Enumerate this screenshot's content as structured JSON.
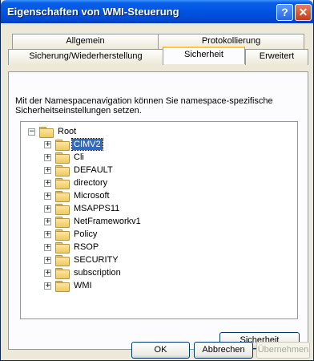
{
  "window": {
    "title": "Eigenschaften von WMI-Steuerung"
  },
  "tabs": {
    "row1": [
      {
        "label": "Allgemein"
      },
      {
        "label": "Protokollierung"
      }
    ],
    "row2": [
      {
        "label": "Sicherung/Wiederherstellung"
      },
      {
        "label": "Sicherheit",
        "active": true
      },
      {
        "label": "Erweitert"
      }
    ]
  },
  "panel": {
    "description": "Mit der Namespacenavigation können Sie namespace-spezifische Sicherheitseinstellungen setzen.",
    "tree": {
      "root": {
        "label": "Root",
        "expander": "−"
      },
      "children": [
        {
          "label": "CIMV2",
          "selected": true,
          "expander": "+"
        },
        {
          "label": "Cli",
          "expander": "+"
        },
        {
          "label": "DEFAULT",
          "expander": "+"
        },
        {
          "label": "directory",
          "expander": "+"
        },
        {
          "label": "Microsoft",
          "expander": "+"
        },
        {
          "label": "MSAPPS11",
          "expander": "+"
        },
        {
          "label": "NetFrameworkv1",
          "expander": "+"
        },
        {
          "label": "Policy",
          "expander": "+"
        },
        {
          "label": "RSOP",
          "expander": "+"
        },
        {
          "label": "SECURITY",
          "expander": "+"
        },
        {
          "label": "subscription",
          "expander": "+"
        },
        {
          "label": "WMI",
          "expander": "+"
        }
      ]
    },
    "security_button": "Sicherheit"
  },
  "footer": {
    "ok": "OK",
    "cancel": "Abbrechen",
    "apply": "Übernehmen"
  },
  "icons": {
    "help": "question-mark",
    "close": "x-mark",
    "folder": "folder"
  }
}
